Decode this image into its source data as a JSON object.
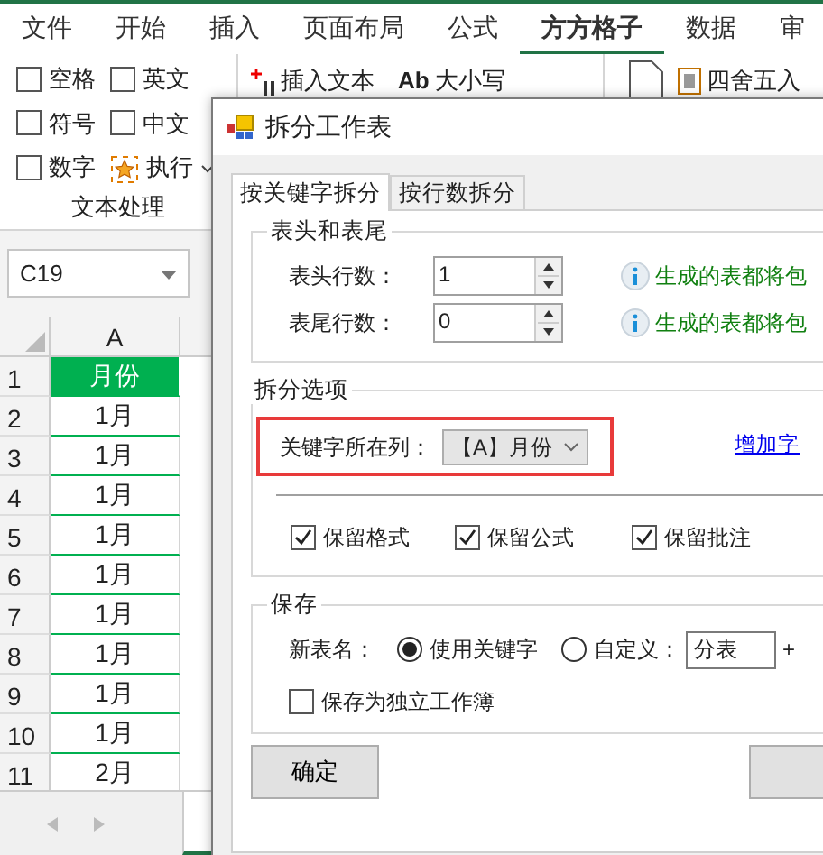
{
  "ribbon": {
    "tabs": [
      {
        "label": "文件",
        "selected": false
      },
      {
        "label": "开始",
        "selected": false
      },
      {
        "label": "插入",
        "selected": false
      },
      {
        "label": "页面布局",
        "selected": false
      },
      {
        "label": "公式",
        "selected": false
      },
      {
        "label": "方方格子",
        "selected": true
      },
      {
        "label": "数据",
        "selected": false
      },
      {
        "label": "审",
        "selected": false
      }
    ],
    "options": [
      {
        "label": "空格",
        "checked": false
      },
      {
        "label": "英文",
        "checked": false
      },
      {
        "label": "符号",
        "checked": false
      },
      {
        "label": "中文",
        "checked": false
      },
      {
        "label": "数字",
        "checked": false
      }
    ],
    "execute": "执行",
    "group_label": "文本处理",
    "insert_text": "插入文本",
    "case_icon": "Ab",
    "case_label": "大小写",
    "round": "四舍五入"
  },
  "name_box": "C19",
  "sheet": {
    "column_header": "A",
    "rows": [
      {
        "number": "1",
        "value": "月份",
        "kind": "header"
      },
      {
        "number": "2",
        "value": "1月",
        "kind": "cell"
      },
      {
        "number": "3",
        "value": "1月",
        "kind": "cell"
      },
      {
        "number": "4",
        "value": "1月",
        "kind": "cell"
      },
      {
        "number": "5",
        "value": "1月",
        "kind": "cell"
      },
      {
        "number": "6",
        "value": "1月",
        "kind": "cell"
      },
      {
        "number": "7",
        "value": "1月",
        "kind": "cell"
      },
      {
        "number": "8",
        "value": "1月",
        "kind": "cell"
      },
      {
        "number": "9",
        "value": "1月",
        "kind": "cell"
      },
      {
        "number": "10",
        "value": "1月",
        "kind": "cell"
      },
      {
        "number": "11",
        "value": "2月",
        "kind": "cell"
      }
    ]
  },
  "dialog": {
    "title": "拆分工作表",
    "tabs": [
      {
        "label": "按关键字拆分",
        "selected": true
      },
      {
        "label": "按行数拆分",
        "selected": false
      }
    ],
    "header_footer": {
      "title": "表头和表尾",
      "rows": [
        {
          "label": "表头行数：",
          "value": "1",
          "hint": "生成的表都将包"
        },
        {
          "label": "表尾行数：",
          "value": "0",
          "hint": "生成的表都将包"
        }
      ]
    },
    "split_options": {
      "title": "拆分选项",
      "key_column_label": "关键字所在列：",
      "key_column_value": "【A】月份",
      "add_link": "增加字",
      "options": [
        {
          "label": "保留格式",
          "checked": true
        },
        {
          "label": "保留公式",
          "checked": true
        },
        {
          "label": "保留批注",
          "checked": true
        }
      ]
    },
    "save": {
      "title": "保存",
      "name_label": "新表名：",
      "choices": [
        {
          "label": "使用关键字",
          "selected": true
        },
        {
          "label": "自定义：",
          "selected": false
        }
      ],
      "custom_value": "分表",
      "suffix": "+",
      "standalone": {
        "label": "保存为独立工作簿",
        "checked": false
      }
    },
    "buttons": [
      "确定"
    ]
  }
}
